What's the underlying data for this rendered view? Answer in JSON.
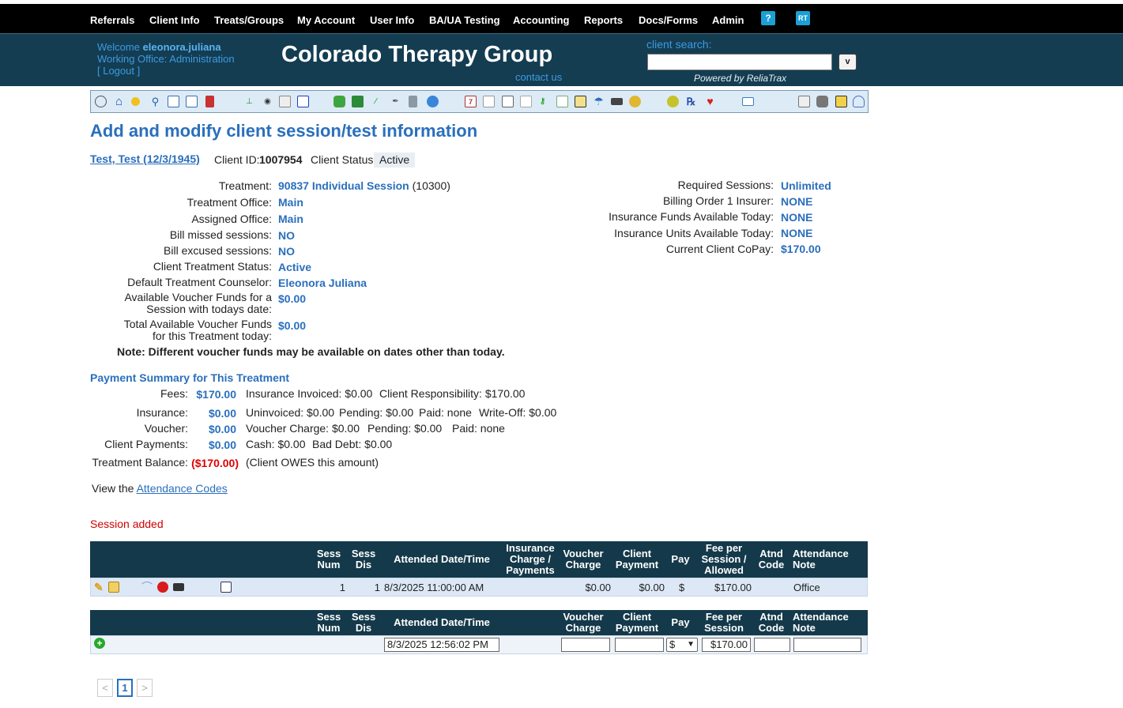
{
  "nav": {
    "items": [
      "Referrals",
      "Client Info",
      "Treats/Groups",
      "My Account",
      "User Info",
      "BA/UA Testing",
      "Accounting",
      "Reports",
      "Docs/Forms",
      "Admin"
    ],
    "help_icon": "?",
    "rt_icon": "RT"
  },
  "header": {
    "welcome_prefix": "Welcome",
    "username": "eleonora.juliana",
    "office_line": "Working Office: Administration",
    "logout": "[ Logout ]",
    "title": "Colorado Therapy Group",
    "contact": "contact us",
    "client_search_label": "client search:",
    "search_button": "v",
    "powered_by": "Powered by ReliaTrax"
  },
  "page_title": "Add and modify client session/test information",
  "client": {
    "name_link": "Test, Test (12/3/1945)",
    "id_label": "Client ID:",
    "id_value": "1007954",
    "status_label": "Client Status:",
    "status_value": "Active"
  },
  "treatment": {
    "treatment_label": "Treatment:",
    "treatment_value": "90837 Individual Session",
    "treatment_code": "(10300)",
    "office_label": "Treatment Office:",
    "office_value": "Main",
    "assigned_label": "Assigned Office:",
    "assigned_value": "Main",
    "bill_missed_label": "Bill missed sessions:",
    "bill_missed_value": "NO",
    "bill_excused_label": "Bill excused sessions:",
    "bill_excused_value": "NO",
    "cts_label": "Client Treatment Status:",
    "cts_value": "Active",
    "counselor_label": "Default Treatment Counselor:",
    "counselor_value": "Eleonora Juliana",
    "voucher_session_label_1": "Available Voucher Funds for a",
    "voucher_session_label_2": "Session with todays date:",
    "voucher_session_value": "$0.00",
    "voucher_total_label_1": "Total Available Voucher Funds",
    "voucher_total_label_2": "for this Treatment today:",
    "voucher_total_value": "$0.00",
    "note": "Note: Different voucher funds may be available on dates other than today."
  },
  "right_info": {
    "required_label": "Required Sessions:",
    "required_value": "Unlimited",
    "billing_label": "Billing Order 1 Insurer:",
    "billing_value": "NONE",
    "funds_label": "Insurance Funds Available Today:",
    "funds_value": "NONE",
    "units_label": "Insurance Units Available Today:",
    "units_value": "NONE",
    "copay_label": "Current Client CoPay:",
    "copay_value": "$170.00"
  },
  "payment_summary": {
    "heading": "Payment Summary for This Treatment",
    "fees_label": "Fees:",
    "fees_value": "$170.00",
    "fees_detail_1": "Insurance Invoiced: $0.00",
    "fees_detail_2": "Client Responsibility: $170.00",
    "insurance_label": "Insurance:",
    "insurance_value": "$0.00",
    "insurance_detail_1": "Uninvoiced: $0.00",
    "insurance_detail_2": "Pending: $0.00",
    "insurance_detail_3": "Paid: none",
    "insurance_detail_4": "Write-Off: $0.00",
    "voucher_label": "Voucher:",
    "voucher_value": "$0.00",
    "voucher_detail_1": "Voucher Charge: $0.00",
    "voucher_detail_2": "Pending: $0.00",
    "voucher_detail_3": "Paid: none",
    "client_payments_label": "Client Payments:",
    "client_payments_value": "$0.00",
    "client_payments_detail_1": "Cash: $0.00",
    "client_payments_detail_2": "Bad Debt: $0.00",
    "balance_label": "Treatment Balance:",
    "balance_value": "($170.00)",
    "balance_detail": "(Client OWES this amount)"
  },
  "attendance": {
    "prefix": "View the",
    "link": "Attendance Codes"
  },
  "message": "Session added",
  "sessions_table": {
    "headers": {
      "sess_num": [
        "Sess",
        "Num"
      ],
      "sess_dis": [
        "Sess",
        "Dis"
      ],
      "attended": "Attended Date/Time",
      "insurance": [
        "Insurance",
        "Charge /",
        "Payments"
      ],
      "voucher": [
        "Voucher",
        "Charge"
      ],
      "client_payment": [
        "Client",
        "Payment"
      ],
      "pay": "Pay",
      "fee": [
        "Fee per",
        "Session /",
        "Allowed"
      ],
      "atnd": [
        "Atnd",
        "Code"
      ],
      "note": [
        "Attendance",
        "Note"
      ]
    },
    "row": {
      "sess_num": "1",
      "sess_dis": "1",
      "attended": "8/3/2025 11:00:00 AM",
      "insurance": "",
      "voucher": "$0.00",
      "client_payment": "$0.00",
      "pay": "$",
      "fee": "$170.00",
      "atnd": "",
      "note": "Office"
    }
  },
  "new_table": {
    "headers": {
      "sess_num": [
        "Sess",
        "Num"
      ],
      "sess_dis": [
        "Sess",
        "Dis"
      ],
      "attended": "Attended Date/Time",
      "voucher": [
        "Voucher",
        "Charge"
      ],
      "client_payment": [
        "Client",
        "Payment"
      ],
      "pay": "Pay",
      "fee": [
        "Fee per",
        "Session"
      ],
      "atnd": [
        "Atnd",
        "Code"
      ],
      "note": [
        "Attendance",
        "Note"
      ]
    },
    "row": {
      "attended_value": "8/3/2025 12:56:02 PM",
      "voucher_value": "",
      "client_payment_value": "",
      "pay_value": "$",
      "fee_value": "$170.00",
      "atnd_value": "",
      "note_value": ""
    }
  },
  "pager": {
    "prev": "<",
    "current": "1",
    "next": ">"
  }
}
